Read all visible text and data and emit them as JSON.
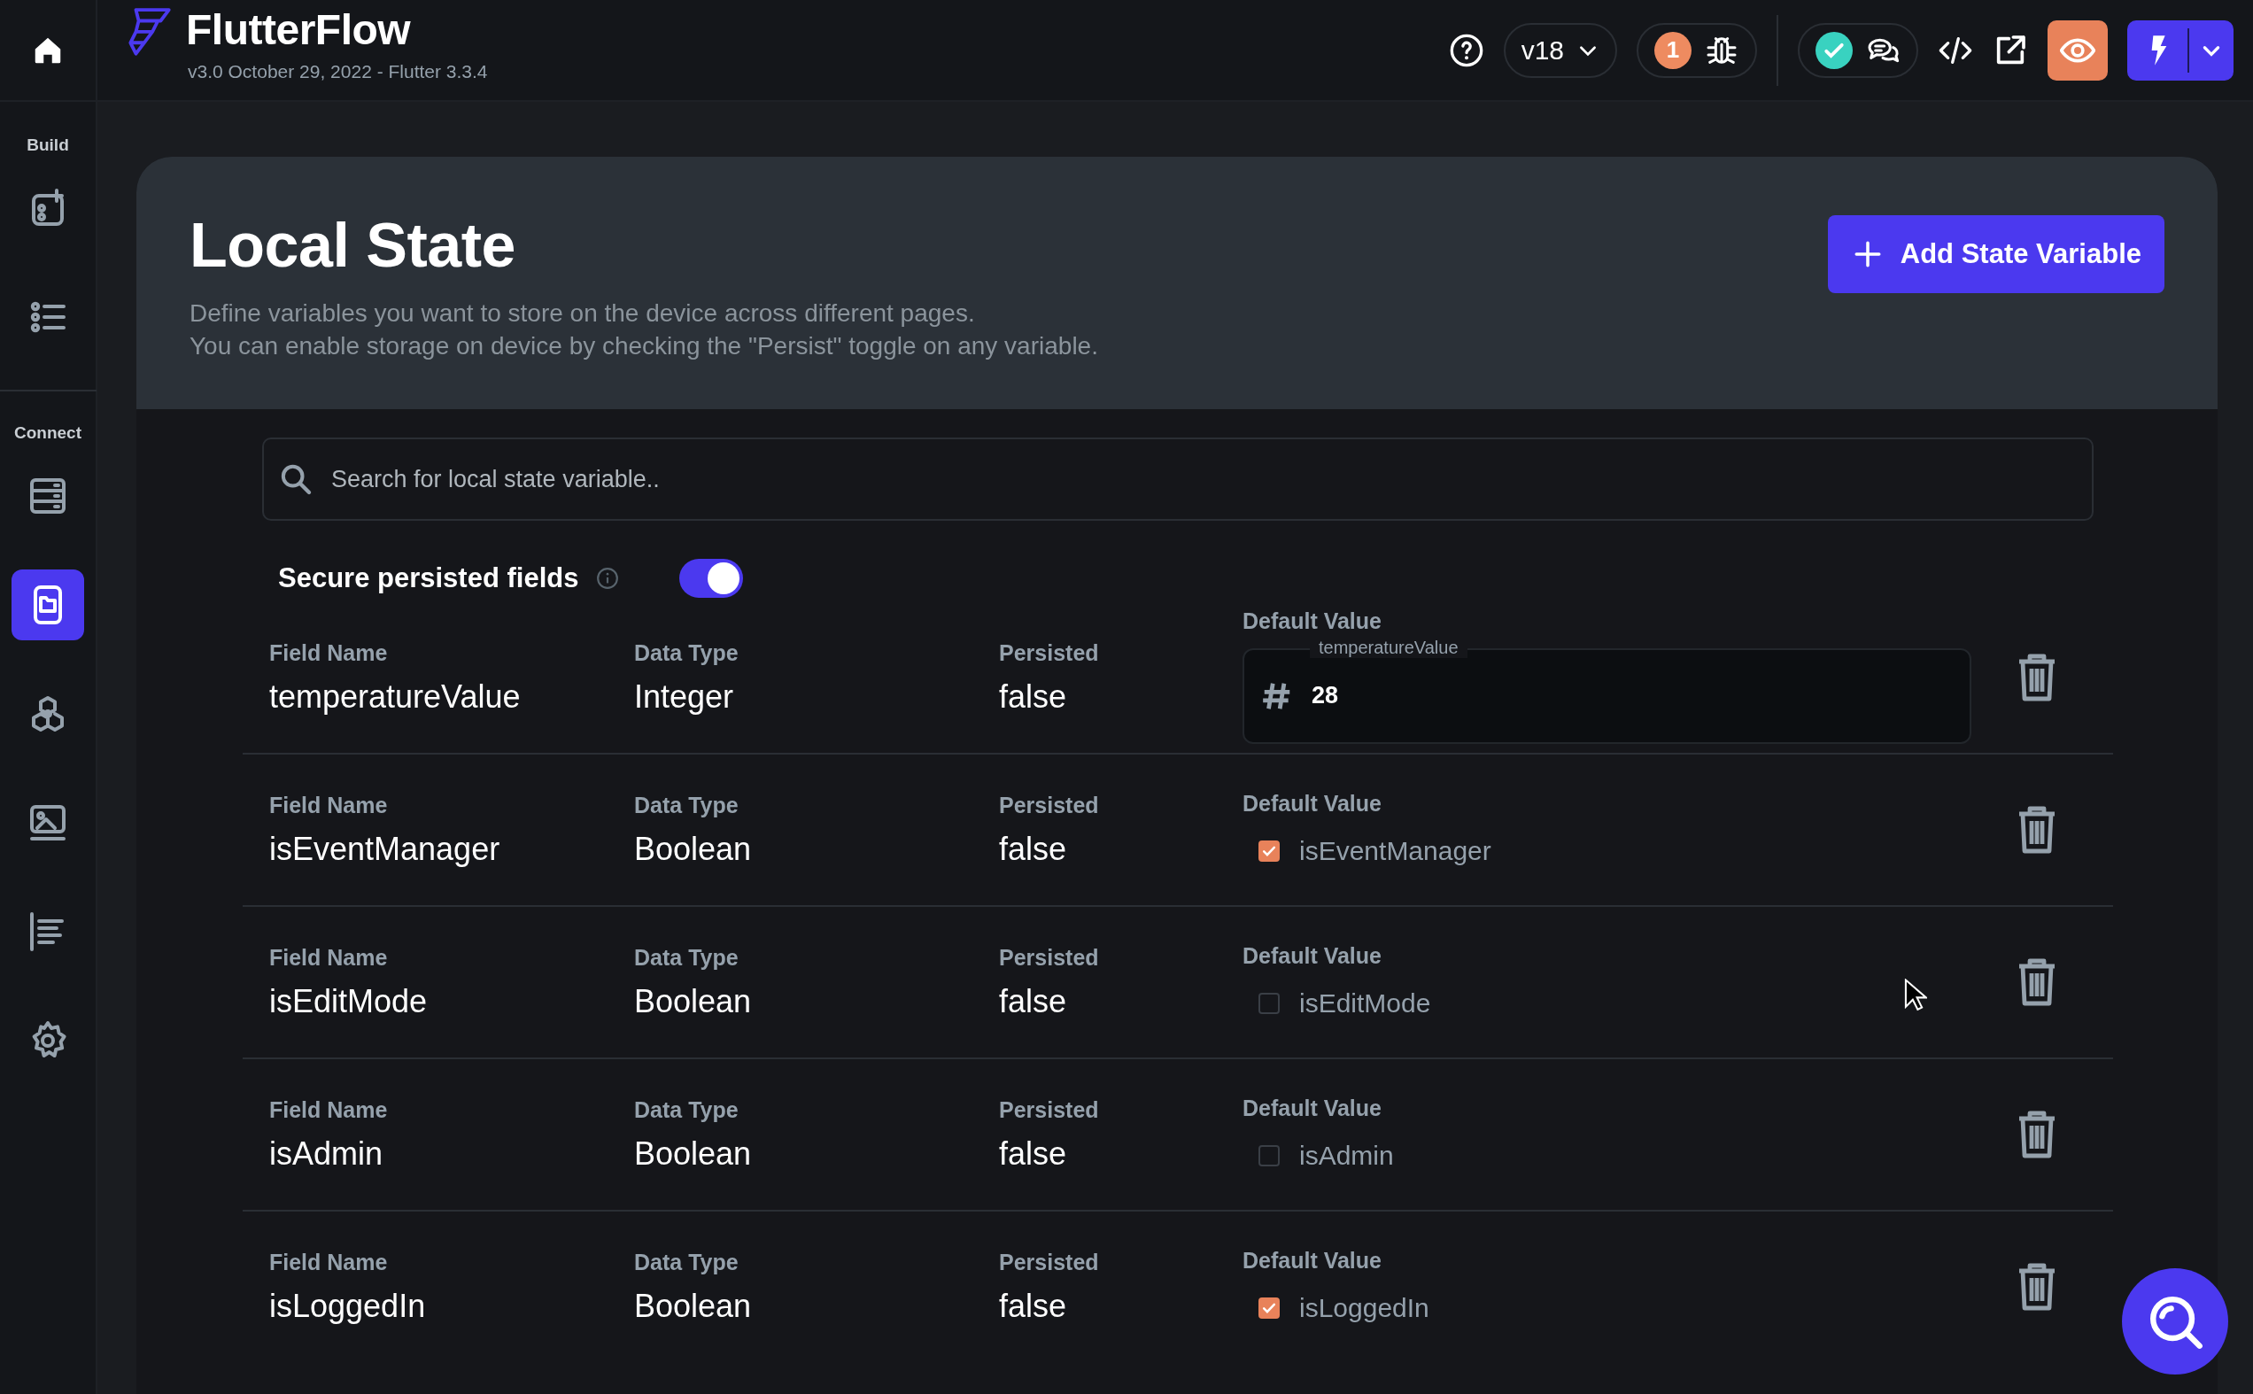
{
  "app": {
    "name": "FlutterFlow",
    "version_info": "v3.0 October 29, 2022 - Flutter 3.3.4"
  },
  "toolbar": {
    "version": "v18",
    "issues_count": "1"
  },
  "sidebar": {
    "sections": [
      {
        "label": "Build",
        "items": [
          {
            "selected": false
          },
          {
            "selected": false
          }
        ]
      },
      {
        "label": "Connect",
        "items": [
          {
            "selected": false
          },
          {
            "selected": true
          },
          {
            "selected": false
          },
          {
            "selected": false
          },
          {
            "selected": false
          },
          {
            "selected": false
          }
        ]
      }
    ]
  },
  "page": {
    "title": "Local State",
    "description": [
      "Define variables you want to store on the device across different pages.",
      "You can enable storage on device by checking the \"Persist\" toggle on any variable."
    ],
    "add_button": "Add State Variable"
  },
  "search": {
    "placeholder": "Search for local state variable.."
  },
  "secure_persisted": {
    "label": "Secure persisted fields",
    "on": true
  },
  "variables": [
    {
      "field_label": "Field Name",
      "field_name": "temperatureValue",
      "type_label": "Data Type",
      "data_type": "Integer",
      "persisted_label": "Persisted",
      "persisted": "false",
      "default_label": "Default Value",
      "kind": "number",
      "input_label": "temperatureValue",
      "value": "28"
    },
    {
      "field_label": "Field Name",
      "field_name": "isEventManager",
      "type_label": "Data Type",
      "data_type": "Boolean",
      "persisted_label": "Persisted",
      "persisted": "false",
      "default_label": "Default Value",
      "kind": "checkbox",
      "checkbox_label": "isEventManager",
      "checked": true
    },
    {
      "field_label": "Field Name",
      "field_name": "isEditMode",
      "type_label": "Data Type",
      "data_type": "Boolean",
      "persisted_label": "Persisted",
      "persisted": "false",
      "default_label": "Default Value",
      "kind": "checkbox",
      "checkbox_label": "isEditMode",
      "checked": false
    },
    {
      "field_label": "Field Name",
      "field_name": "isAdmin",
      "type_label": "Data Type",
      "data_type": "Boolean",
      "persisted_label": "Persisted",
      "persisted": "false",
      "default_label": "Default Value",
      "kind": "checkbox",
      "checkbox_label": "isAdmin",
      "checked": false
    },
    {
      "field_label": "Field Name",
      "field_name": "isLoggedIn",
      "type_label": "Data Type",
      "data_type": "Boolean",
      "persisted_label": "Persisted",
      "persisted": "false",
      "default_label": "Default Value",
      "kind": "checkbox",
      "checkbox_label": "isLoggedIn",
      "checked": true
    }
  ]
}
